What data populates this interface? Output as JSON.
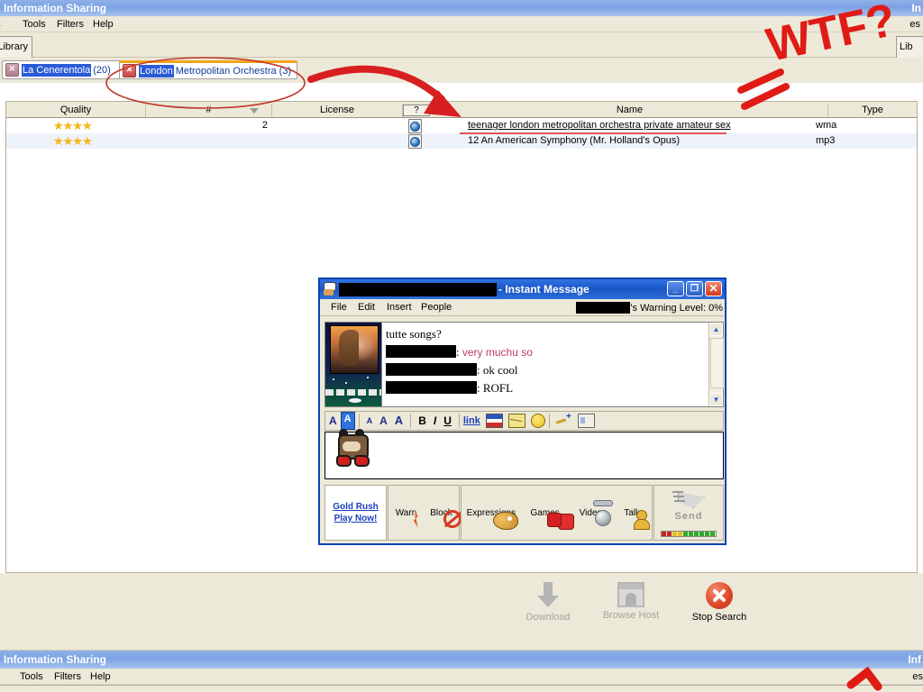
{
  "app": {
    "title": "Information Sharing",
    "title_right_clip": "In",
    "menu": [
      "es",
      "Tools",
      "Filters",
      "Help"
    ],
    "menu_right_clip": "es",
    "library_tab": "Library",
    "library_tab_right_clip": "Lib"
  },
  "search_tabs": [
    {
      "close": "✕",
      "highlight": "La Cenerentola",
      "rest": "(20)",
      "active": false
    },
    {
      "close": "✕",
      "highlight": "London",
      "rest": "Metropolitan Orchestra  (3)",
      "active": true
    }
  ],
  "results": {
    "columns": [
      {
        "label": "Quality"
      },
      {
        "label": "#"
      },
      {
        "label": "License"
      },
      {
        "label": "?"
      },
      {
        "label": "Name"
      },
      {
        "label": "Type"
      }
    ],
    "rows": [
      {
        "quality": "★★★★",
        "count": "2",
        "license": "",
        "name": "teenager london metropolitan orchestra private amateur sex",
        "type": "wma",
        "highlighted": true
      },
      {
        "quality": "★★★★",
        "count": "",
        "license": "",
        "name": "12 An American Symphony (Mr. Holland's Opus)",
        "type": "mp3",
        "highlighted": false
      }
    ]
  },
  "actions": [
    {
      "label": "Download",
      "icon": "download-arrow-icon",
      "enabled": false
    },
    {
      "label": "Browse Host",
      "icon": "browse-host-icon",
      "enabled": false
    },
    {
      "label": "Stop Search",
      "icon": "stop-search-icon",
      "enabled": true
    }
  ],
  "annotations": {
    "wtf_text": "WTF?",
    "color": "#e01b16"
  },
  "im": {
    "title_suffix": "- Instant Message",
    "window_buttons": {
      "minimize": "_",
      "maximize": "❐",
      "close": "✕"
    },
    "menu": [
      "File",
      "Edit",
      "Insert",
      "People"
    ],
    "warning_label": "'s Warning Level: 0%",
    "conversation": [
      {
        "sender": null,
        "text": "tutte songs?",
        "style": "plain"
      },
      {
        "sender": "[redacted]",
        "sep": ": ",
        "text": "very muchu so",
        "style": "pink"
      },
      {
        "sender": "[redacted]",
        "sep": ": ",
        "text": "ok cool",
        "style": "plain"
      },
      {
        "sender": "[redacted]",
        "sep": ": ",
        "text": "ROFL",
        "style": "plain"
      }
    ],
    "format_toolbar": [
      {
        "name": "font-color-a-icon",
        "glyph": "A"
      },
      {
        "name": "background-color-a-icon",
        "glyph": "A"
      },
      {
        "name": "decrease-font-size-icon",
        "glyph": "A"
      },
      {
        "name": "font-size-icon",
        "glyph": "A"
      },
      {
        "name": "increase-font-size-icon",
        "glyph": "A"
      },
      {
        "name": "bold-icon",
        "glyph": "B"
      },
      {
        "name": "italic-icon",
        "glyph": "I"
      },
      {
        "name": "underline-icon",
        "glyph": "U"
      },
      {
        "name": "hyperlink-icon",
        "glyph": "link"
      },
      {
        "name": "flag-image-icon",
        "glyph": ""
      },
      {
        "name": "mail-icon",
        "glyph": ""
      },
      {
        "name": "smiley-icon",
        "glyph": ""
      },
      {
        "name": "signature-icon",
        "glyph": ""
      },
      {
        "name": "buddy-card-icon",
        "glyph": ""
      }
    ],
    "input_value": "",
    "gold_rush": {
      "line1": "Gold Rush",
      "line2": "Play Now!"
    },
    "buttons": [
      {
        "label": "Warn",
        "icon": "warn-lightning-icon"
      },
      {
        "label": "Block",
        "icon": "block-icon"
      },
      {
        "label": "Expressions",
        "icon": "expressions-palette-icon"
      },
      {
        "label": "Games",
        "icon": "games-dice-icon"
      },
      {
        "label": "Video",
        "icon": "video-camera-icon"
      },
      {
        "label": "Talk",
        "icon": "talk-person-icon"
      }
    ],
    "send": {
      "label": "Send",
      "icon": "send-plane-icon"
    }
  },
  "duplicate_strip": {
    "title": "Information Sharing",
    "title_right_clip": "Inf",
    "menu": [
      "es",
      "Tools",
      "Filters",
      "Help"
    ],
    "menu_right_clip": "es"
  }
}
